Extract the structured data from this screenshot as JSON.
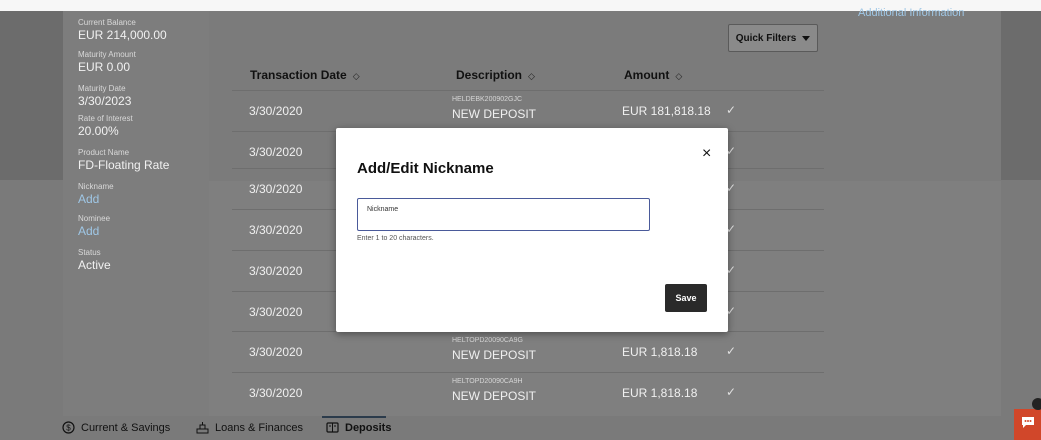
{
  "summary": [
    {
      "label": "Current Balance",
      "value": "EUR 214,000.00"
    },
    {
      "label": "Maturity Amount",
      "value": "EUR 0.00"
    },
    {
      "label": "Maturity Date",
      "value": "3/30/2023"
    },
    {
      "label": "Rate of Interest",
      "value": "20.00%"
    },
    {
      "label": "Product Name",
      "value": "FD-Floating Rate"
    },
    {
      "label": "Nickname",
      "link": "Add"
    },
    {
      "label": "Nominee",
      "link": "Add"
    },
    {
      "label": "Status",
      "value": "Active"
    }
  ],
  "additional_info": "Additional Information",
  "quick_filters": "Quick Filters",
  "table": {
    "headers": {
      "date": "Transaction Date",
      "description": "Description",
      "amount": "Amount"
    },
    "rows": [
      {
        "date": "3/30/2020",
        "ref": "HELDEBK200902GJC",
        "desc": "NEW DEPOSIT",
        "amount": "EUR 181,818.18",
        "check": "✓"
      },
      {
        "date": "3/30/2020",
        "ref": "",
        "desc": "",
        "amount": "",
        "check": "✓"
      },
      {
        "date": "3/30/2020",
        "ref": "",
        "desc": "",
        "amount": "",
        "check": "✓"
      },
      {
        "date": "3/30/2020",
        "ref": "",
        "desc": "",
        "amount": "",
        "check": "✓"
      },
      {
        "date": "3/30/2020",
        "ref": "",
        "desc": "",
        "amount": "",
        "check": "✓"
      },
      {
        "date": "3/30/2020",
        "ref": "",
        "desc": "",
        "amount": "",
        "check": "✓"
      },
      {
        "date": "3/30/2020",
        "ref": "HELTOPD20090CA9G",
        "desc": "NEW DEPOSIT",
        "amount": "EUR 1,818.18",
        "check": "✓"
      },
      {
        "date": "3/30/2020",
        "ref": "HELTOPD20090CA9H",
        "desc": "NEW DEPOSIT",
        "amount": "EUR 1,818.18",
        "check": "✓"
      }
    ]
  },
  "tabs": [
    {
      "label": "Current & Savings",
      "icon": "currency-circle-icon"
    },
    {
      "label": "Loans & Finances",
      "icon": "loans-icon"
    },
    {
      "label": "Deposits",
      "icon": "deposits-icon"
    }
  ],
  "modal": {
    "title": "Add/Edit Nickname",
    "close": "×",
    "input_placeholder": "Nickname",
    "hint": "Enter 1 to 20 characters.",
    "save": "Save"
  },
  "colors": {
    "accent": "#2a2a2a",
    "chat": "#d1472a",
    "link": "#9fc7e6"
  }
}
